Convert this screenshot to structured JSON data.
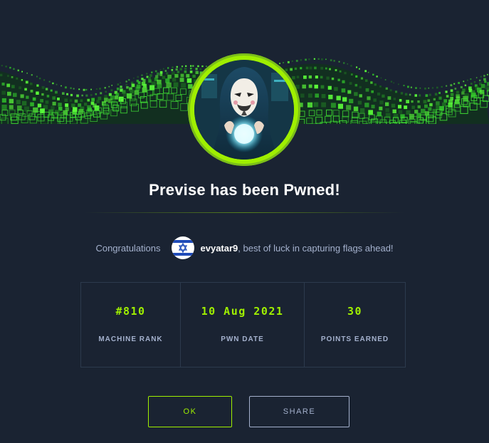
{
  "colors": {
    "background": "#1a2332",
    "accent": "#9fef00",
    "text_muted": "#a4b1cd",
    "text_white": "#ffffff",
    "border": "#2c3a4d"
  },
  "header": {
    "banner_icon": "green-cube-wave-banner",
    "avatar_icon": "hooded-masked-hacker-avatar"
  },
  "title": "Previse has been Pwned!",
  "congrats": {
    "prefix": "Congratulations",
    "flag_icon": "israel-flag-icon",
    "username": "evyatar9",
    "suffix": ", best of luck in capturing flags ahead!"
  },
  "stats": [
    {
      "value": "#810",
      "label": "MACHINE RANK"
    },
    {
      "value": "10 Aug 2021",
      "label": "PWN DATE"
    },
    {
      "value": "30",
      "label": "POINTS EARNED"
    }
  ],
  "buttons": {
    "ok": "OK",
    "share": "SHARE"
  }
}
